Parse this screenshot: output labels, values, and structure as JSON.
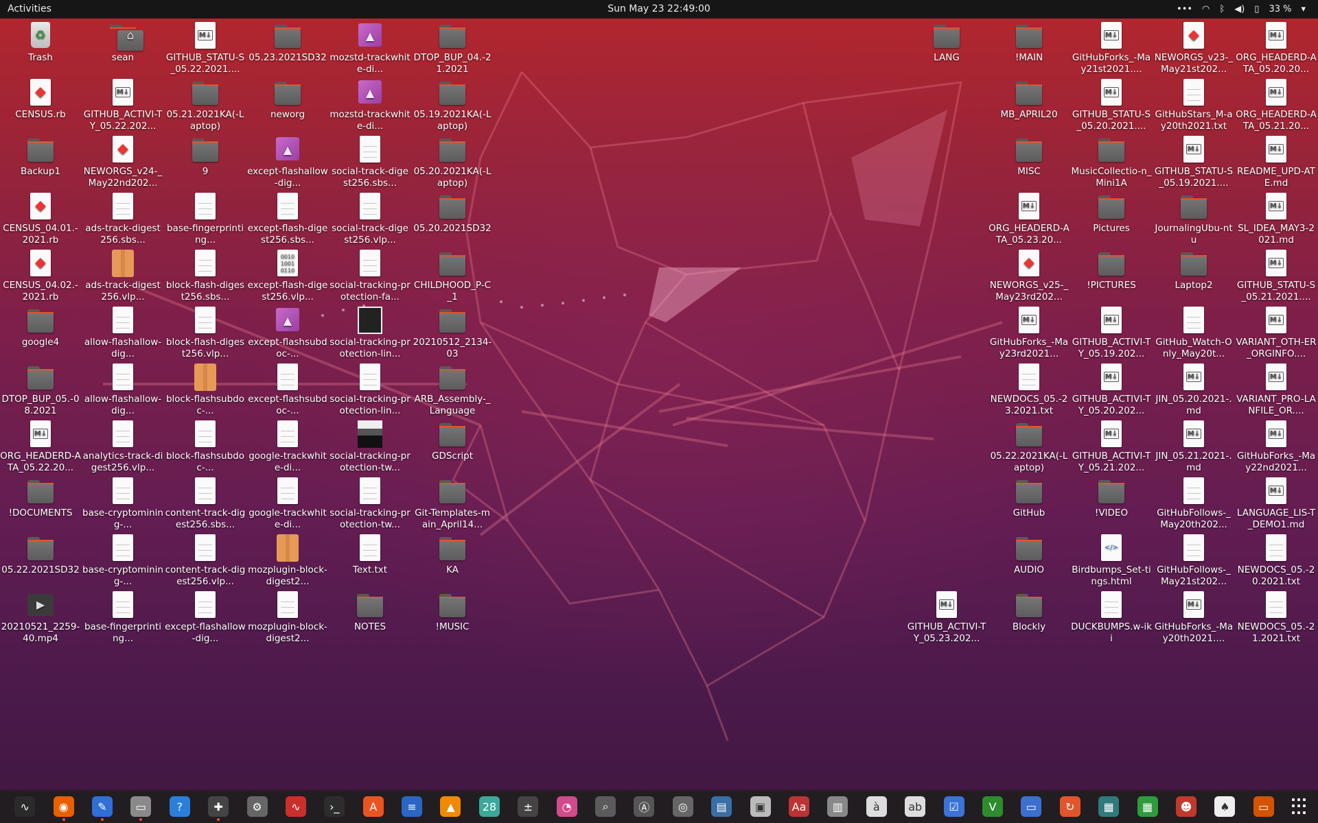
{
  "topbar": {
    "activities": "Activities",
    "clock": "Sun May 23  22:49:00",
    "battery": "33 %",
    "tray_icons": [
      "menu-dots-icon",
      "wifi-icon",
      "bluetooth-icon",
      "volume-icon",
      "battery-icon"
    ]
  },
  "colors": {
    "topbar": "#161616",
    "accent": "#e95420",
    "wallpaper_top": "#b5262d",
    "wallpaper_bottom": "#3f173f"
  },
  "desktop": {
    "left": [
      [
        "Trash",
        "CENSUS.rb",
        "Backup1",
        "CENSUS_04.01.-2021.rb",
        "CENSUS_04.02.-2021.rb",
        "google4",
        "DTOP_BUP_05.-08.2021",
        "ORG_HEADERD-ATA_05.22.20...",
        "!DOCUMENTS",
        "05.22.2021SD32",
        "20210521_2259-40.mp4"
      ],
      [
        "sean",
        "GITHUB_ACTIVI-TY_05.22.202...",
        "NEWORGS_v24-_May22nd202...",
        "ads-track-digest256.sbs...",
        "ads-track-digest256.vlp...",
        "allow-flashallow-dig...",
        "allow-flashallow-dig...",
        "analytics-track-digest256.vlp...",
        "base-cryptomining-...",
        "base-cryptomining-...",
        "base-fingerprinting..."
      ],
      [
        "GITHUB_STATU-S_05.22.2021....",
        "05.21.2021KA(-Laptop)",
        "9",
        "base-fingerprinting...",
        "block-flash-digest256.sbs...",
        "block-flash-digest256.vlp...",
        "block-flashsubdoc-...",
        "block-flashsubdoc-...",
        "content-track-digest256.sbs...",
        "content-track-digest256.vlp...",
        "except-flashallow-dig..."
      ],
      [
        "05.23.2021SD32",
        "neworg",
        "except-flashallow-dig...",
        "except-flash-digest256.sbs...",
        "except-flash-digest256.vlp...",
        "except-flashsubdoc-...",
        "except-flashsubdoc-...",
        "google-trackwhite-di...",
        "google-trackwhite-di...",
        "mozplugin-block-digest2...",
        "mozplugin-block-digest2..."
      ],
      [
        "mozstd-trackwhite-di...",
        "mozstd-trackwhite-di...",
        "social-track-digest256.sbs...",
        "social-track-digest256.vlp...",
        "social-tracking-protection-fa...",
        "social-tracking-protection-lin...",
        "social-tracking-protection-lin...",
        "social-tracking-protection-tw...",
        "social-tracking-protection-tw...",
        "Text.txt",
        "NOTES"
      ],
      [
        "DTOP_BUP_04.-21.2021",
        "05.19.2021KA(-Laptop)",
        "05.20.2021KA(-Laptop)",
        "05.20.2021SD32",
        "CHILDHOOD_P-C_1",
        "20210512_2134-03",
        "ARB_Assembly-_Language",
        "GDScript",
        "Git-Templates-main_April14...",
        "KA",
        "!MUSIC"
      ]
    ],
    "right": [
      [
        "LANG",
        "",
        "",
        "",
        "",
        "",
        "",
        "",
        "",
        "",
        "GITHUB_ACTIVI-TY_05.23.202..."
      ],
      [
        "!MAIN",
        "MB_APRIL20",
        "MISC",
        "ORG_HEADERD-ATA_05.23.20...",
        "NEWORGS_v25-_May23rd202...",
        "GitHubForks_-May23rd2021...",
        "NEWDOCS_05.-23.2021.txt",
        "05.22.2021KA(-Laptop)",
        "GitHub",
        "AUDIO",
        "Blockly"
      ],
      [
        "GitHubForks_-May21st2021....",
        "GITHUB_STATU-S_05.20.2021....",
        "MusicCollectio-n_Mini1A",
        "Pictures",
        "!PICTURES",
        "GITHUB_ACTIVI-TY_05.19.202...",
        "GITHUB_ACTIVI-TY_05.20.202...",
        "GITHUB_ACTIVI-TY_05.21.202...",
        "!VIDEO",
        "Birdbumps_Set-tings.html",
        "DUCKBUMPS.w-iki"
      ],
      [
        "NEWORGS_v23-_May21st202...",
        "GitHubStars_M-ay20th2021.txt",
        "GITHUB_STATU-S_05.19.2021....",
        "JournalingUbu-ntu",
        "Laptop2",
        "GitHub_Watch-Only_May20t...",
        "JIN_05.20.2021-.md",
        "JIN_05.21.2021-.md",
        "GitHubFollows-_May20th202...",
        "GitHubFollows-_May21st202...",
        "GitHubForks_-May20th2021...."
      ],
      [
        "ORG_HEADERD-ATA_05.20.20...",
        "ORG_HEADERD-ATA_05.21.20...",
        "README_UPD-ATE.md",
        "SL_IDEA_MAY3-2021.md",
        "GITHUB_STATU-S_05.21.2021....",
        "VARIANT_OTH-ER_ORGINFO....",
        "VARIANT_PRO-LANFILE_OR....",
        "GitHubForks_-May22nd2021...",
        "LANGUAGE_LIS-T_DEMO1.md",
        "NEWDOCS_05.-20.2021.txt",
        "NEWDOCS_05.-21.2021.txt"
      ]
    ],
    "left_types": [
      [
        "trash",
        "ruby",
        "folder",
        "ruby",
        "ruby",
        "folder",
        "folder",
        "md",
        "folder",
        "folder",
        "video"
      ],
      [
        "home",
        "md",
        "ruby",
        "page",
        "archive",
        "page",
        "page",
        "page",
        "page",
        "page",
        "page"
      ],
      [
        "md",
        "folder",
        "folder",
        "page",
        "page",
        "page",
        "archive",
        "page",
        "page",
        "page",
        "page"
      ],
      [
        "folder",
        "folder",
        "image",
        "page",
        "binary",
        "image",
        "page",
        "page",
        "page",
        "archive",
        "page"
      ],
      [
        "image",
        "image",
        "page",
        "page",
        "page",
        "thumb-dark",
        "page",
        "thumb-photo",
        "page",
        "page",
        "folder"
      ],
      [
        "folder",
        "folder",
        "folder",
        "folder",
        "folder",
        "folder",
        "folder",
        "folder",
        "folder",
        "folder",
        "folder"
      ]
    ],
    "right_types": [
      [
        "folder",
        "",
        "",
        "",
        "",
        "",
        "",
        "",
        "",
        "",
        "md"
      ],
      [
        "folder",
        "folder",
        "folder",
        "md",
        "ruby",
        "md",
        "page",
        "folder",
        "folder",
        "folder",
        "folder"
      ],
      [
        "md",
        "md",
        "folder",
        "folder",
        "folder",
        "md",
        "md",
        "md",
        "folder",
        "html",
        "page"
      ],
      [
        "ruby",
        "page",
        "md",
        "folder",
        "folder",
        "page",
        "md",
        "md",
        "page",
        "page",
        "md"
      ],
      [
        "md",
        "md",
        "md",
        "md",
        "md",
        "md",
        "md",
        "md",
        "md",
        "page",
        "page"
      ]
    ]
  },
  "dock": [
    {
      "name": "system-monitor-icon",
      "color": "#2a2a2a",
      "glyph": "∿"
    },
    {
      "name": "firefox-icon",
      "color": "#e66000",
      "glyph": "◉",
      "running": true
    },
    {
      "name": "text-editor-icon",
      "color": "#2f6fd6",
      "glyph": "✎",
      "running": true
    },
    {
      "name": "files-icon",
      "color": "#8a8a8a",
      "glyph": "▭",
      "running": true
    },
    {
      "name": "help-icon",
      "color": "#2b7fd8",
      "glyph": "?"
    },
    {
      "name": "extensions-icon",
      "color": "#444",
      "glyph": "✚",
      "running": true
    },
    {
      "name": "settings-icon",
      "color": "#666",
      "glyph": "⚙"
    },
    {
      "name": "audio-editor-icon",
      "color": "#c9302c",
      "glyph": "∿"
    },
    {
      "name": "terminal-icon",
      "color": "#2d2d2d",
      "glyph": "›_"
    },
    {
      "name": "software-store-icon",
      "color": "#e95420",
      "glyph": "A"
    },
    {
      "name": "writer-icon",
      "color": "#2a66c3",
      "glyph": "≡"
    },
    {
      "name": "vlc-icon",
      "color": "#f08a00",
      "glyph": "▲"
    },
    {
      "name": "calendar-icon",
      "color": "#3aa89a",
      "glyph": "28"
    },
    {
      "name": "calculator-icon",
      "color": "#444",
      "glyph": "±"
    },
    {
      "name": "disk-usage-icon",
      "color": "#d14a8b",
      "glyph": "◔"
    },
    {
      "name": "image-viewer-icon",
      "color": "#5b5b5b",
      "glyph": "⌕"
    },
    {
      "name": "ubuntu-updater-icon",
      "color": "#555",
      "glyph": "Ⓐ"
    },
    {
      "name": "disks-icon",
      "color": "#666",
      "glyph": "◎"
    },
    {
      "name": "document-viewer-icon",
      "color": "#3a6ea5",
      "glyph": "▤"
    },
    {
      "name": "screenshot-icon",
      "color": "#bbb",
      "glyph": "▣"
    },
    {
      "name": "dictionary-icon",
      "color": "#b33",
      "glyph": "Aa"
    },
    {
      "name": "archive-manager-icon",
      "color": "#888",
      "glyph": "▥"
    },
    {
      "name": "character-map-icon",
      "color": "#ddd",
      "glyph": "à"
    },
    {
      "name": "fonts-icon",
      "color": "#ddd",
      "glyph": "ab"
    },
    {
      "name": "tasks-icon",
      "color": "#3b73d6",
      "glyph": "☑"
    },
    {
      "name": "vim-icon",
      "color": "#2e8b2e",
      "glyph": "V"
    },
    {
      "name": "remote-desktop-icon",
      "color": "#3d6fd0",
      "glyph": "▭"
    },
    {
      "name": "backup-icon",
      "color": "#e2552a",
      "glyph": "↻"
    },
    {
      "name": "mahjongg-icon",
      "color": "#2f7a7a",
      "glyph": "▦"
    },
    {
      "name": "calc-spreadsheet-icon",
      "color": "#2e9b3d",
      "glyph": "▦"
    },
    {
      "name": "game-mario-icon",
      "color": "#c0392b",
      "glyph": "☻"
    },
    {
      "name": "cards-icon",
      "color": "#eee",
      "glyph": "♠"
    },
    {
      "name": "presentation-icon",
      "color": "#d35400",
      "glyph": "▭"
    }
  ]
}
